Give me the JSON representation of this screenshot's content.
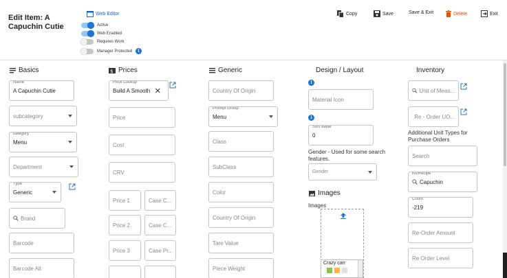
{
  "header": {
    "title": "Edit Item: A Capuchin Cutie",
    "web_editor": "Web Editor",
    "toggles": [
      {
        "label": "Active",
        "on": true
      },
      {
        "label": "Web Enabled",
        "on": true
      },
      {
        "label": "Requires Work",
        "on": false
      },
      {
        "label": "Manager Protected",
        "on": false
      }
    ]
  },
  "toolbar": {
    "copy": "Copy",
    "save": "Save",
    "save_exit": "Save & Exit",
    "delete": "Delete",
    "exit": "Exit",
    "delete_color": "#e65100"
  },
  "basics": {
    "heading": "Basics",
    "name_label": "Name",
    "name_value": "A Capuchin Cutie",
    "subcategory_placeholder": "subcategory",
    "category_label": "category",
    "category_value": "Menu",
    "department_placeholder": "Department",
    "type_label": "Type",
    "type_value": "Generic",
    "brand_placeholder": "Brand",
    "barcode_placeholder": "Barcode",
    "barcode_alt_placeholder": "Barcode Alt"
  },
  "prices": {
    "heading": "Prices",
    "lookup_label": "Price Lookup",
    "lookup_value": "Build A Smooth",
    "price": "Price",
    "cost": "Cost",
    "crv": "CRV",
    "price1": "Price 1",
    "case1": "Case C...",
    "price2": "Price 2",
    "case2": "Case C...",
    "price3": "Price 3",
    "case3": "Case Pr..."
  },
  "generic": {
    "heading": "Generic",
    "country_origin": "Country Of Origin",
    "prompt_group_label": "Prompt Group",
    "prompt_group_value": "Menu",
    "class": "Class",
    "subclass": "SubClass",
    "color": "Color",
    "country_origin2": "Country Of Origin",
    "tare_value": "Tare Value",
    "piece_weight": "Piece Weight"
  },
  "design": {
    "heading": "Design / Layout",
    "material_icon": "Material Icon",
    "sort_label": "Sort Value",
    "sort_value": "0",
    "gender_note": "Gender - Used for some search features.",
    "gender_placeholder": "Gender",
    "images_heading": "Images",
    "images_label": "Images",
    "image_file": "Crazy carr"
  },
  "inventory": {
    "heading": "Inventory",
    "unit_measure": "Unit of Meas...",
    "reorder_uom": "Re - Order UO...",
    "additional_units": "Additional Unit Types for Purchase Orders",
    "search": "Search",
    "kit_label": "Kit/Recipe",
    "kit_value": "Capuchin",
    "count_label": "Count",
    "count_value": "-219",
    "reorder_amount": "Re-Order Amount",
    "reorder_level": "Re Order Level"
  },
  "colors": {
    "accent": "#1976d2"
  }
}
